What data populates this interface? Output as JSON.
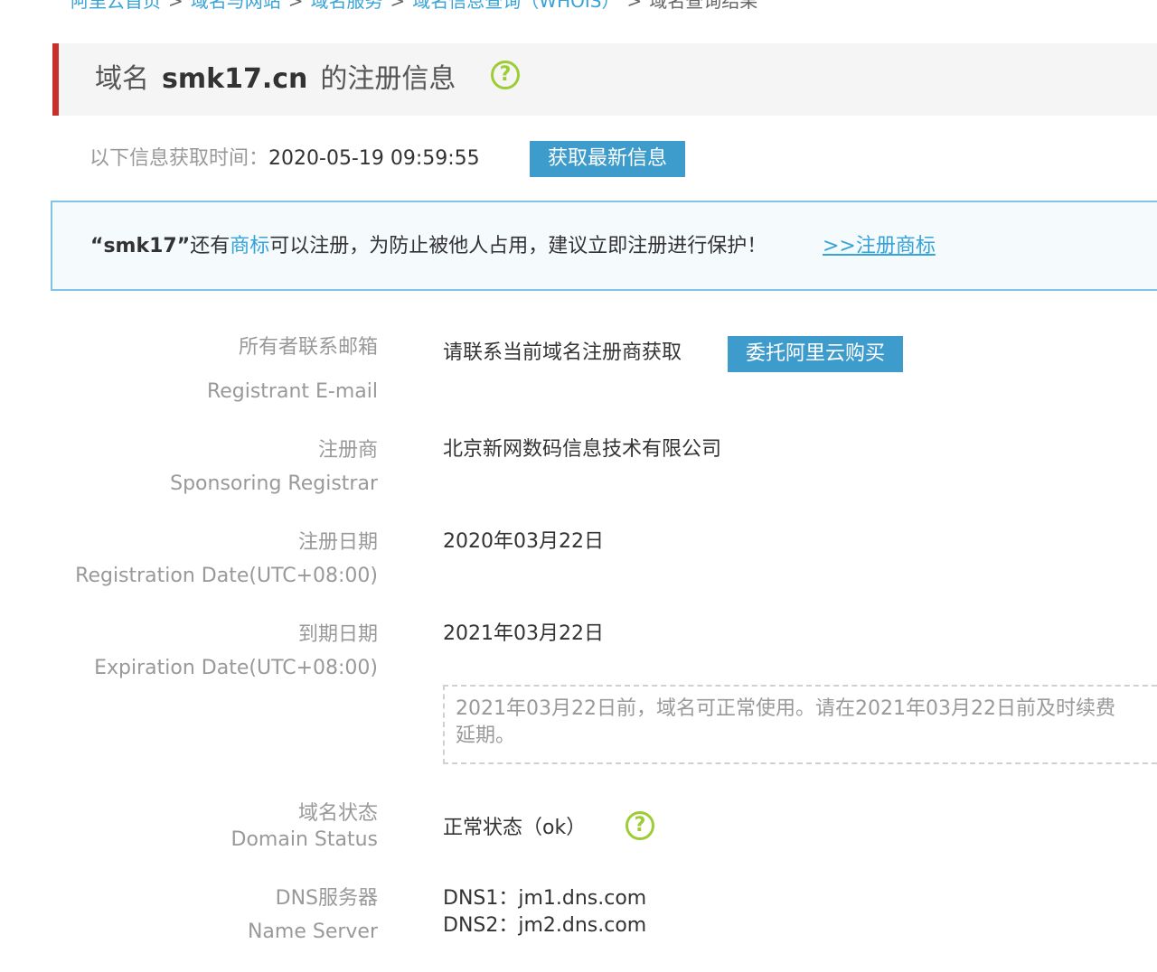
{
  "breadcrumb": {
    "items": [
      "阿里云首页",
      "域名与网站",
      "域名服务",
      "域名信息查询（WHOIS）"
    ],
    "current": "域名查询结果",
    "separator": ">"
  },
  "title": {
    "prefix": "域名",
    "domain": "smk17.cn",
    "suffix": "的注册信息",
    "help_icon": "help-circle-icon"
  },
  "fetch": {
    "label": "以下信息获取时间：",
    "time": "2020-05-19 09:59:55",
    "button": "获取最新信息"
  },
  "notice": {
    "quote_name": "“smk17”",
    "text1": "还有",
    "highlight": "商标",
    "text2": "可以注册，为防止被他人占用，建议立即注册进行保护！",
    "link": ">>注册商标"
  },
  "rows": {
    "email": {
      "label_cn": "所有者联系邮箱",
      "label_en": "Registrant E-mail",
      "value": "请联系当前域名注册商获取",
      "button": "委托阿里云购买"
    },
    "registrar": {
      "label_cn": "注册商",
      "label_en": "Sponsoring Registrar",
      "value": "北京新网数码信息技术有限公司"
    },
    "reg_date": {
      "label_cn": "注册日期",
      "label_en": "Registration Date(UTC+08:00)",
      "value": "2020年03月22日"
    },
    "exp_date": {
      "label_cn": "到期日期",
      "label_en": "Expiration Date(UTC+08:00)",
      "value": "2021年03月22日",
      "note_line1": "2021年03月22日前，域名可正常使用。请在2021年03月22日前及时续费",
      "note_line2": "延期。"
    },
    "status": {
      "label_cn": "域名状态",
      "label_en": "Domain Status",
      "value": "正常状态（ok）",
      "help_icon": "help-circle-icon"
    },
    "dns": {
      "label_cn": "DNS服务器",
      "label_en": "Name Server",
      "dns1": "DNS1：jm1.dns.com",
      "dns2": "DNS2：jm2.dns.com"
    }
  },
  "colors": {
    "accent_red": "#c8302b",
    "link_blue": "#36a3d9",
    "button_blue": "#3e9ccc",
    "help_green": "#9ccd34"
  }
}
